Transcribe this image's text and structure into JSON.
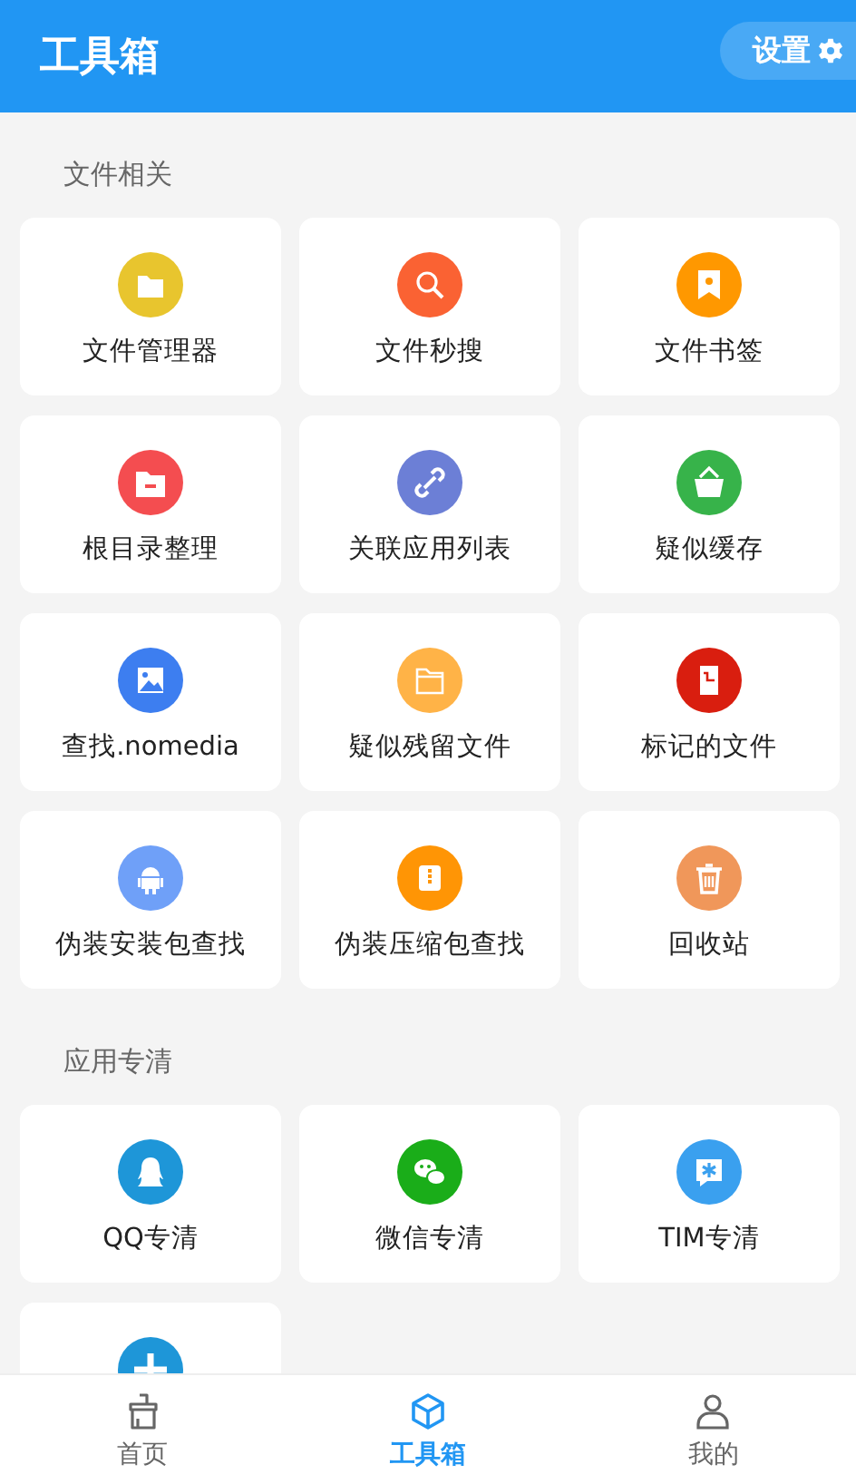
{
  "header": {
    "title": "工具箱",
    "settings_button": {
      "label": "设置"
    }
  },
  "sections": [
    {
      "title": "文件相关",
      "items": [
        {
          "label": "文件管理器",
          "kind": "folder",
          "color": "#e8c52e"
        },
        {
          "label": "文件秒搜",
          "kind": "search",
          "color": "#fa6233"
        },
        {
          "label": "文件书签",
          "kind": "bookmark",
          "color": "#ff9800"
        },
        {
          "label": "根目录整理",
          "kind": "folder-minus",
          "color": "#f44d50"
        },
        {
          "label": "关联应用列表",
          "kind": "link",
          "color": "#6c7fd6"
        },
        {
          "label": "疑似缓存",
          "kind": "basket",
          "color": "#37b34a"
        },
        {
          "label": "查找.nomedia",
          "kind": "image",
          "color": "#3d7ef0"
        },
        {
          "label": "疑似残留文件",
          "kind": "folder-outline",
          "color": "#ffb347"
        },
        {
          "label": "标记的文件",
          "kind": "document",
          "color": "#d91e0f"
        },
        {
          "label": "伪装安装包查找",
          "kind": "android",
          "color": "#6fa0f8"
        },
        {
          "label": "伪装压缩包查找",
          "kind": "archive",
          "color": "#ff9505"
        },
        {
          "label": "回收站",
          "kind": "trash",
          "color": "#f0975a"
        }
      ]
    },
    {
      "title": "应用专清",
      "items": [
        {
          "label": "QQ专清",
          "kind": "penguin",
          "color": "#1e96d8"
        },
        {
          "label": "微信专清",
          "kind": "chat",
          "color": "#1aad19"
        },
        {
          "label": "TIM专清",
          "kind": "star-bubble",
          "color": "#3aa0ef"
        },
        {
          "kind": "plus",
          "color": "#1e96d8"
        }
      ]
    }
  ],
  "bottom_nav": [
    {
      "label": "首页",
      "kind": "broom",
      "selected": false
    },
    {
      "label": "工具箱",
      "kind": "cube",
      "selected": true
    },
    {
      "label": "我的",
      "kind": "person",
      "selected": false
    }
  ]
}
